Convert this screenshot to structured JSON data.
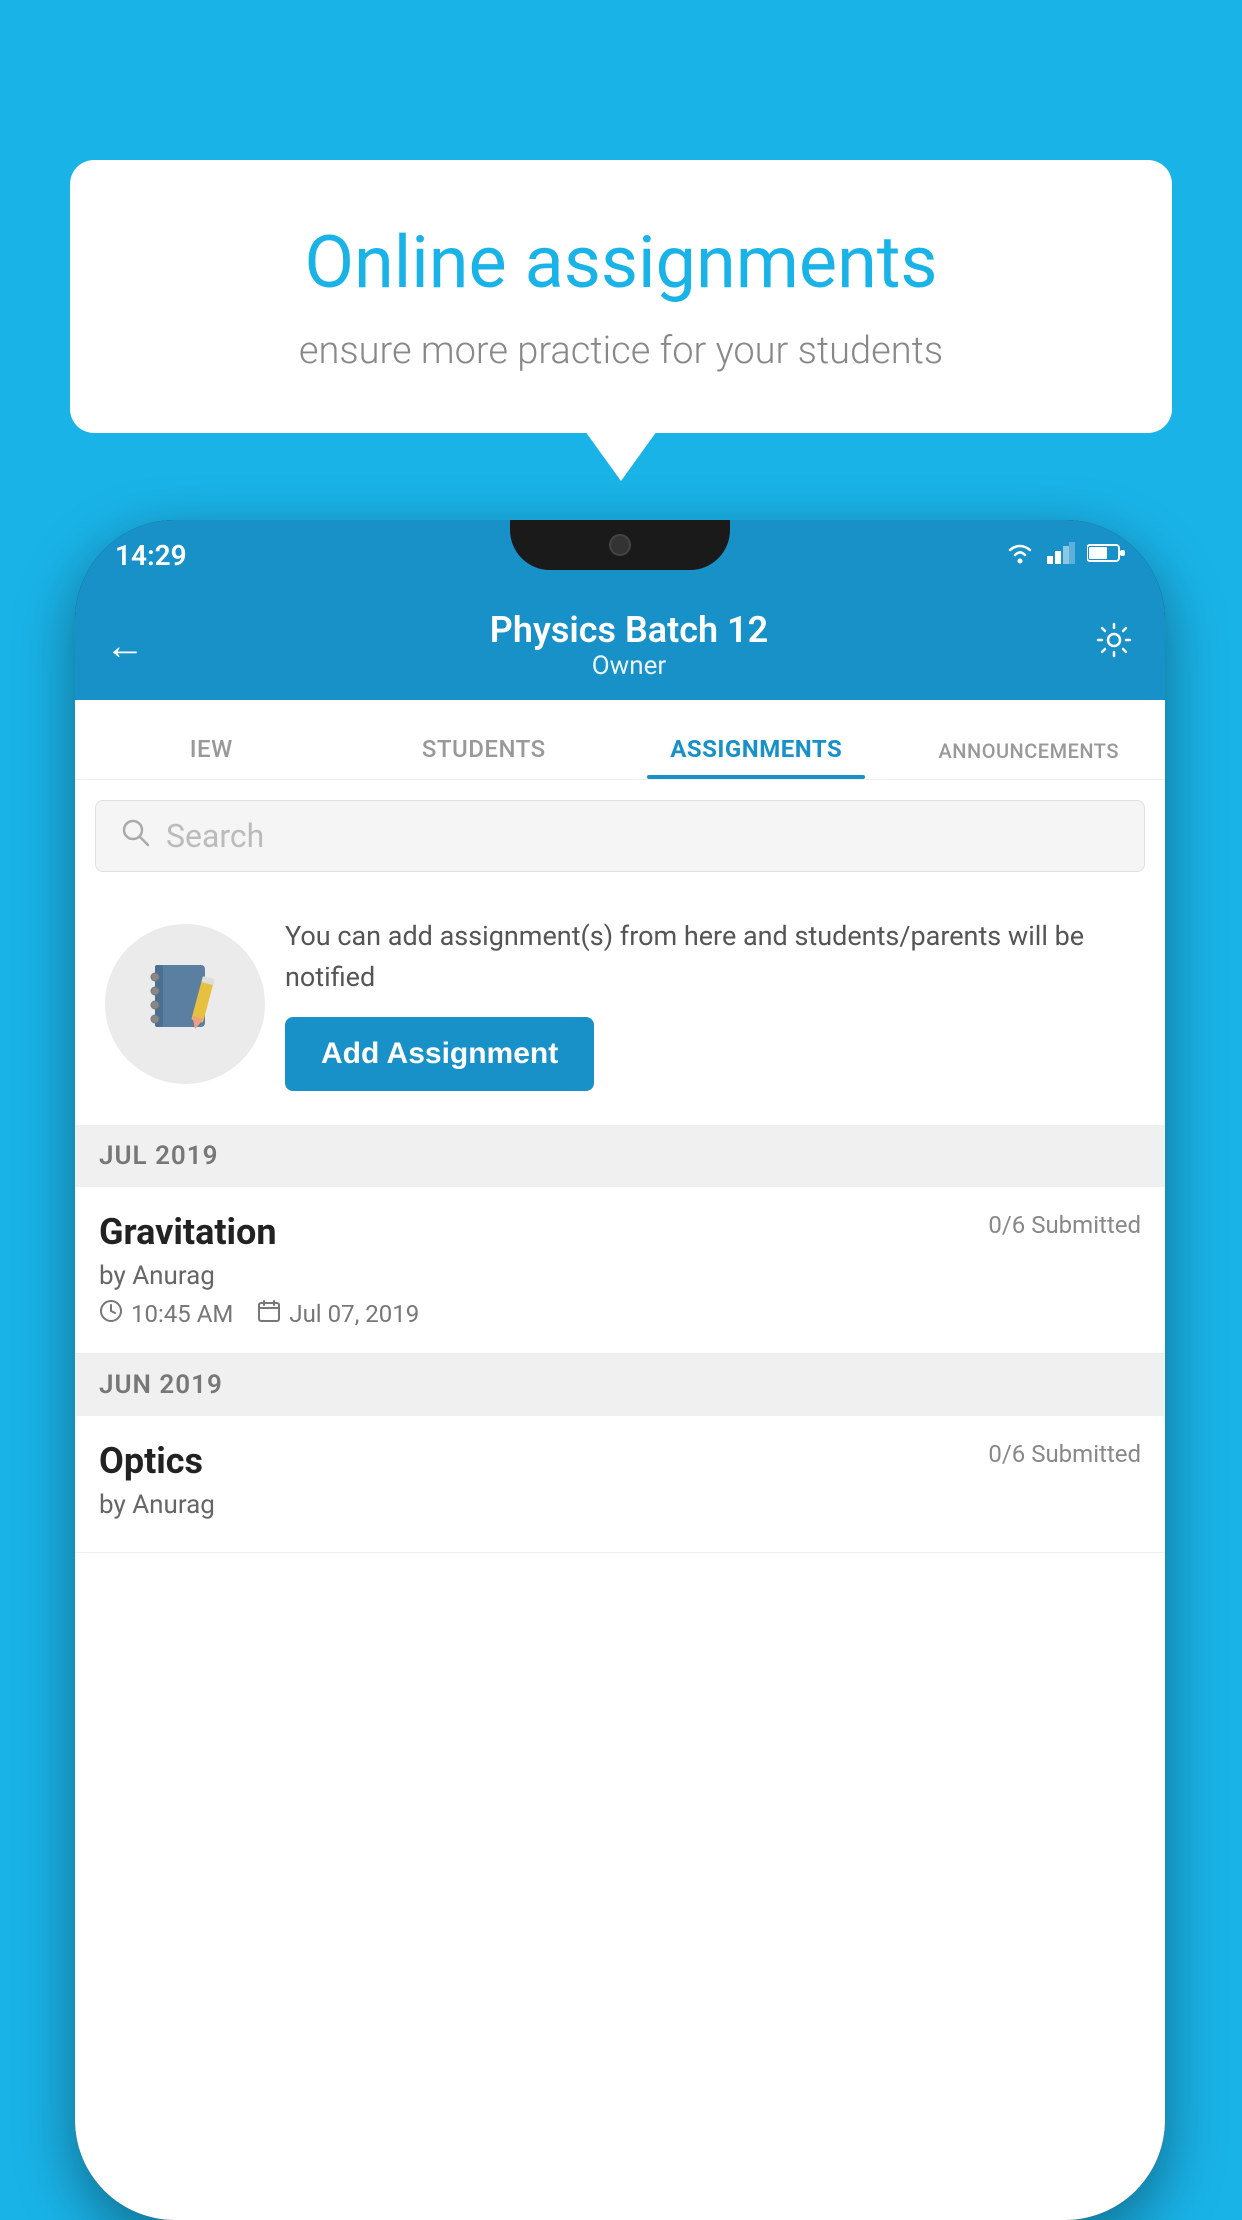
{
  "background_color": "#1ab3e8",
  "speech_bubble": {
    "title": "Online assignments",
    "subtitle": "ensure more practice for your students"
  },
  "status_bar": {
    "time": "14:29"
  },
  "header": {
    "title": "Physics Batch 12",
    "subtitle": "Owner",
    "back_label": "←",
    "settings_label": "⚙"
  },
  "tabs": [
    {
      "label": "IEW",
      "active": false
    },
    {
      "label": "STUDENTS",
      "active": false
    },
    {
      "label": "ASSIGNMENTS",
      "active": true
    },
    {
      "label": "ANNOUNCEMENTS",
      "active": false
    }
  ],
  "search": {
    "placeholder": "Search"
  },
  "promo": {
    "description": "You can add assignment(s) from here and students/parents will be notified",
    "button_label": "Add Assignment"
  },
  "sections": [
    {
      "month": "JUL 2019",
      "assignments": [
        {
          "title": "Gravitation",
          "submitted": "0/6 Submitted",
          "author": "by Anurag",
          "time": "10:45 AM",
          "date": "Jul 07, 2019"
        }
      ]
    },
    {
      "month": "JUN 2019",
      "assignments": [
        {
          "title": "Optics",
          "submitted": "0/6 Submitted",
          "author": "by Anurag",
          "time": "",
          "date": ""
        }
      ]
    }
  ]
}
